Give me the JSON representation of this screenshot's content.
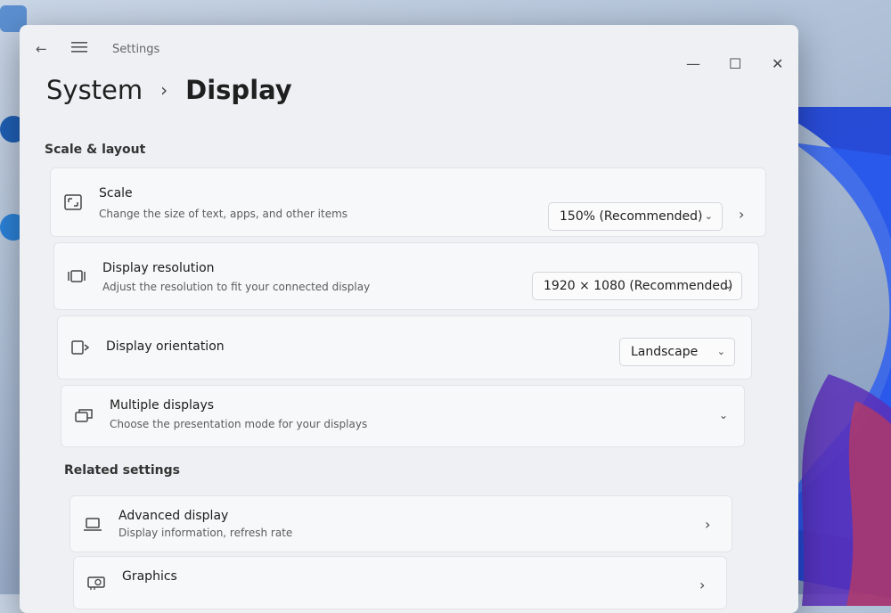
{
  "window": {
    "title": "Settings",
    "back_icon": "back-arrow-icon",
    "menu_icon": "hamburger-menu-icon"
  },
  "breadcrumb": {
    "parent": "System",
    "separator": "›",
    "current": "Display"
  },
  "sections": {
    "scale_layout": "Scale & layout",
    "related": "Related settings"
  },
  "scale": {
    "title": "Scale",
    "desc": "Change the size of text, apps, and other items",
    "value": "150% (Recommended)"
  },
  "resolution": {
    "title": "Display resolution",
    "desc": "Adjust the resolution to fit your connected display",
    "value": "1920 × 1080 (Recommended)"
  },
  "orientation": {
    "title": "Display orientation",
    "value": "Landscape"
  },
  "multiple": {
    "title": "Multiple displays",
    "desc": "Choose the presentation mode for your displays"
  },
  "advanced": {
    "title": "Advanced display",
    "desc": "Display information, refresh rate"
  },
  "graphics": {
    "title": "Graphics"
  },
  "glyphs": {
    "chevron_down": "⌄",
    "chevron_right": "›",
    "minimize": "—",
    "maximize": "☐",
    "close": "✕",
    "back": "←"
  },
  "colors": {
    "window_bg": "#eef0f3",
    "card_bg": "#f7f8f9",
    "wallpaper_accent": "#1a3fd6"
  }
}
